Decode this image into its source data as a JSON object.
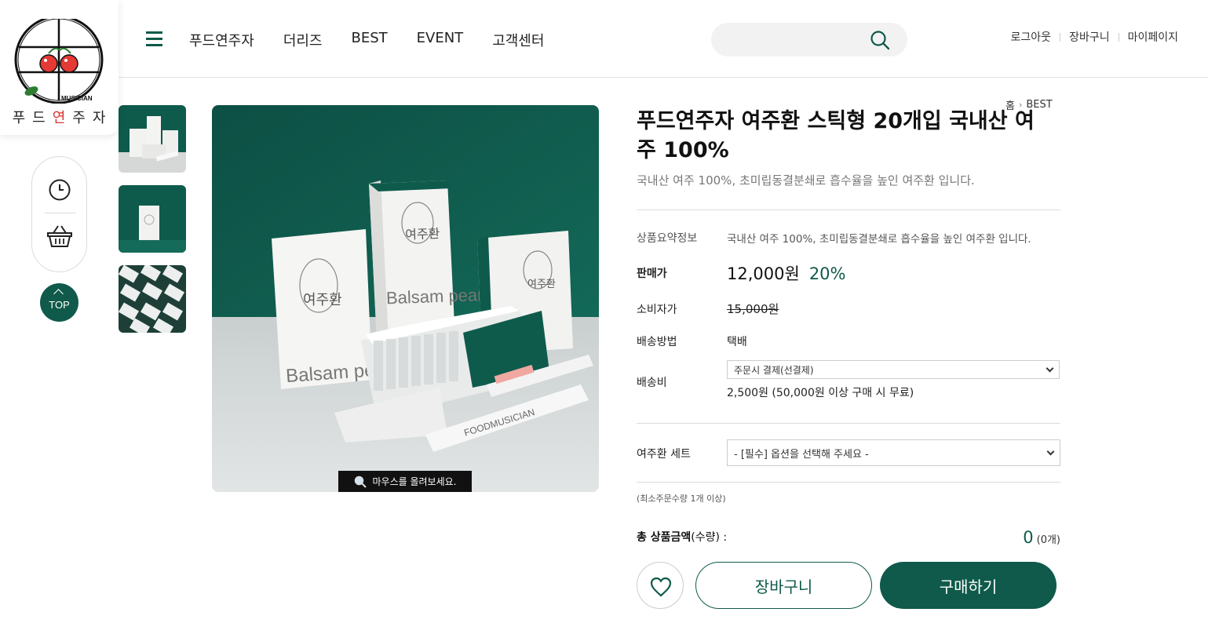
{
  "brand": {
    "logo_text": "푸드연주자",
    "logo_word": "MUSICIAN",
    "accent": "#0f5a4a"
  },
  "nav": {
    "items": [
      "푸드연주자",
      "더리즈",
      "BEST",
      "EVENT",
      "고객센터"
    ]
  },
  "search": {
    "value": "",
    "placeholder": ""
  },
  "util": {
    "logout": "로그아웃",
    "cart": "장바구니",
    "mypage": "마이페이지"
  },
  "quick": {
    "top_label": "TOP"
  },
  "breadcrumb": {
    "home": "홈",
    "current": "BEST"
  },
  "product": {
    "title": "푸드연주자 여주환 스틱형 20개입 국내산 여주 100%",
    "subtitle": "국내산 여주 100%, 초미립동결분쇄로 흡수율을 높인 여주환 입니다.",
    "image_tip": "마우스를 올려보세요.",
    "box_label_main": "여주환",
    "box_label_en": "Balsam pear",
    "stick_label": "FOODMUSICIAN"
  },
  "info": {
    "summary_label": "상품요약정보",
    "summary_value": "국내산 여주 100%, 초미립동결분쇄로 흡수율을 높인 여주환 입니다.",
    "sale_label": "판매가",
    "sale_price": "12,000원",
    "discount": "20%",
    "consumer_label": "소비자가",
    "consumer_price": "15,000원",
    "shipping_method_label": "배송방법",
    "shipping_method": "택배",
    "shipping_fee_label": "배송비",
    "shipping_fee_select": "주문시 결제(선결제)",
    "shipping_fee_text": "2,500원 (50,000원 이상 구매 시 무료)"
  },
  "option": {
    "label": "여주환 세트",
    "select": "- [필수] 옵션을 선택해 주세요 -"
  },
  "min_order": "(최소주문수량 1개 이상)",
  "total": {
    "label": "총 상품금액",
    "label_suffix": "(수량) :",
    "amount": "0",
    "count": "(0개)"
  },
  "actions": {
    "cart": "장바구니",
    "buy": "구매하기"
  }
}
